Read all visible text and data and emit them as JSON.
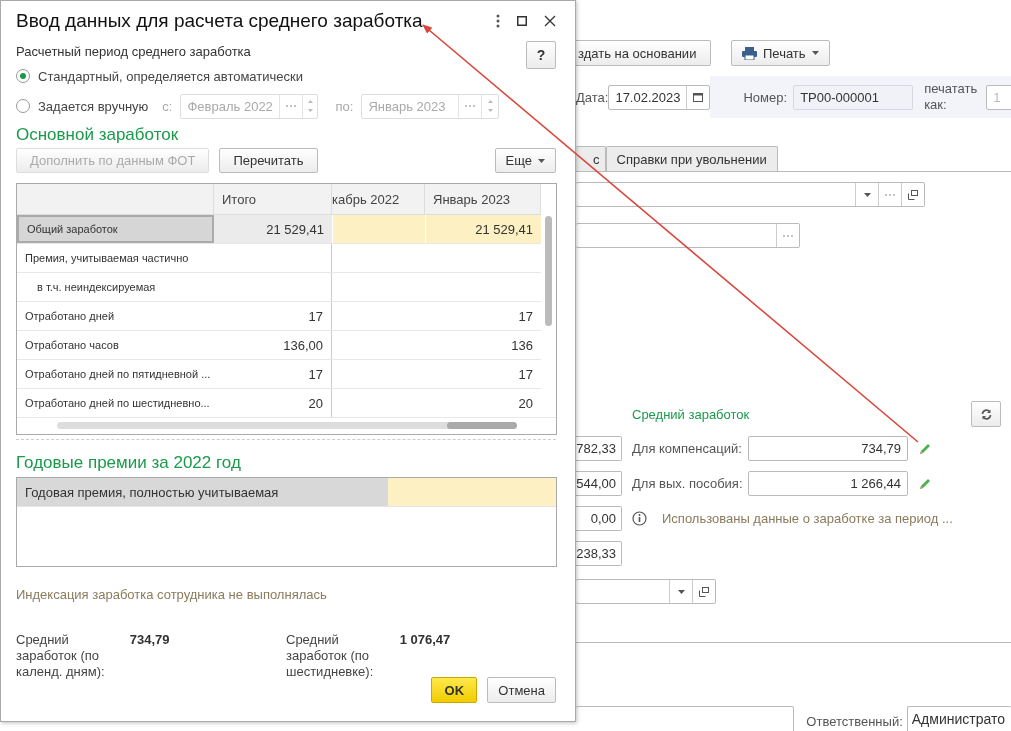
{
  "document": {
    "toolbar": [
      {
        "label": "здать на основании",
        "kind": "dropdown"
      },
      {
        "label": "Печать",
        "kind": "print"
      }
    ],
    "date_label": "Дата:",
    "date_value": "17.02.2023",
    "number_label": "Номер:",
    "number_value": "ТР00-000001",
    "print_as_label": "печатать как:",
    "print_as_value": "1",
    "tabs": [
      {
        "label": "с",
        "selected": false
      },
      {
        "label": "Справки при увольнении",
        "selected": false
      }
    ],
    "average": {
      "title": "Средний заработок",
      "rows": [
        {
          "amount": "782,33",
          "kind": "edit",
          "label": "Для компенсаций:",
          "value": "734,79"
        },
        {
          "amount": "544,00",
          "kind": "edit",
          "label": "Для вых. пособия:",
          "value": "1 266,44"
        },
        {
          "amount": "0,00",
          "kind": "info",
          "note": "Использованы данные о заработке за период ..."
        },
        {
          "amount": "238,33",
          "kind": "plain"
        }
      ]
    },
    "responsible_label": "Ответственный:",
    "responsible_value": "Администрато"
  },
  "dialog": {
    "title": "Ввод данных для расчета среднего заработка",
    "period_label": "Расчетный период среднего заработка",
    "help_button": "?",
    "period_options": [
      {
        "label": "Стандартный, определяется автоматически",
        "selected": true
      },
      {
        "label": "Задается вручную",
        "selected": false
      }
    ],
    "period_range": {
      "from_label": "с:",
      "from_value": "Февраль 2022",
      "to_label": "по:",
      "to_value": "Январь 2023",
      "disabled": true
    },
    "main_section": {
      "title": "Основной заработок",
      "buttons": [
        {
          "label": "Дополнить по данным ФОТ",
          "disabled": true
        },
        {
          "label": "Перечитать",
          "disabled": false
        }
      ],
      "more_button": "Еще",
      "table": {
        "columns": [
          "Итого",
          "кабрь 2022",
          "Январь 2023"
        ],
        "rows": [
          {
            "label": "Общий заработок",
            "total": "21 529,41",
            "column_3": "21 529,41",
            "selected": true
          },
          {
            "label": "Премия, учитываемая частично",
            "selected": false,
            "children": [
              {
                "label": "в т.ч. неиндексируемая",
                "selected": false
              }
            ]
          },
          {
            "label": "Отработано дней",
            "total": "17",
            "column_3": "17",
            "selected": false
          },
          {
            "label": "Отработано часов",
            "total": "136,00",
            "column_3": "136",
            "selected": false
          },
          {
            "label": "Отработано дней по пятидневной ...",
            "total": "17",
            "column_3": "17",
            "selected": false
          },
          {
            "label": "Отработано дней по шестидневно...",
            "total": "20",
            "column_3": "20",
            "selected": false
          }
        ]
      }
    },
    "bonus_section": {
      "title": "Годовые премии за 2022 год",
      "rows": [
        {
          "label": "Годовая премия, полностью учитываемая",
          "selected": true
        }
      ]
    },
    "indexation_note": "Индексация заработка сотрудника не выполнялась",
    "summaries": [
      {
        "label": "Средний заработок (по календ. дням):",
        "value": "734,79"
      },
      {
        "label": "Средний заработок (по шестидневке):",
        "value": "1 076,47"
      }
    ],
    "buttons": [
      {
        "label": "OK",
        "kind": "primary"
      },
      {
        "label": "Отмена",
        "kind": "default"
      }
    ]
  }
}
